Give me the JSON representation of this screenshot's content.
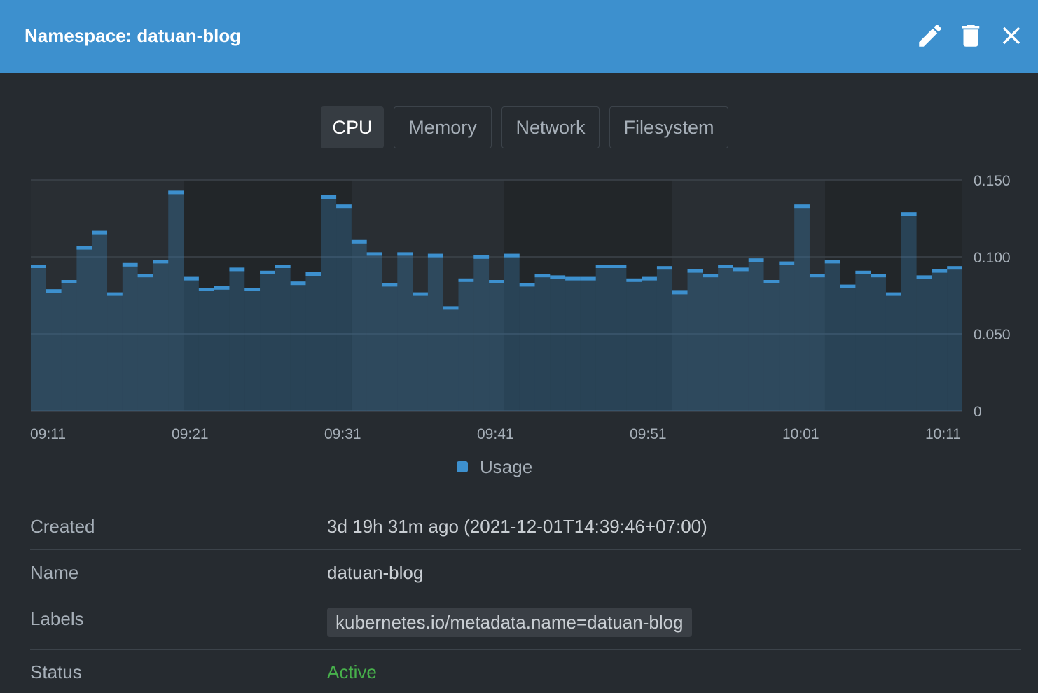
{
  "header": {
    "title": "Namespace: datuan-blog",
    "actions": [
      {
        "name": "edit",
        "icon": "pencil-icon"
      },
      {
        "name": "delete",
        "icon": "trash-icon"
      },
      {
        "name": "close",
        "icon": "close-icon"
      }
    ]
  },
  "tabs": [
    {
      "label": "CPU",
      "active": true
    },
    {
      "label": "Memory",
      "active": false
    },
    {
      "label": "Network",
      "active": false
    },
    {
      "label": "Filesystem",
      "active": false
    }
  ],
  "chart_data": {
    "type": "bar",
    "series": [
      {
        "name": "Usage",
        "color": "#3d90ce",
        "values": [
          0.095,
          0.079,
          0.085,
          0.107,
          0.117,
          0.077,
          0.096,
          0.089,
          0.098,
          0.143,
          0.087,
          0.08,
          0.081,
          0.093,
          0.08,
          0.091,
          0.095,
          0.084,
          0.09,
          0.14,
          0.134,
          0.111,
          0.103,
          0.083,
          0.103,
          0.077,
          0.102,
          0.068,
          0.086,
          0.101,
          0.085,
          0.102,
          0.083,
          0.089,
          0.088,
          0.087,
          0.087,
          0.095,
          0.095,
          0.086,
          0.087,
          0.094,
          0.078,
          0.092,
          0.089,
          0.095,
          0.093,
          0.099,
          0.085,
          0.097,
          0.134,
          0.089,
          0.098,
          0.082,
          0.091,
          0.089,
          0.077,
          0.129,
          0.088,
          0.092,
          0.094
        ]
      }
    ],
    "x_tick_labels": [
      "09:11",
      "09:21",
      "09:31",
      "09:41",
      "09:51",
      "10:01",
      "10:11"
    ],
    "y_tick_labels": [
      "0.150",
      "0.100",
      "0.050",
      "0"
    ],
    "y_ticks": [
      0.15,
      0.1,
      0.05,
      0
    ],
    "ylim": [
      0,
      0.15
    ],
    "grid": true,
    "legend_placement": "bottom-center"
  },
  "legend": {
    "label": "Usage",
    "color": "#3d90ce"
  },
  "details": [
    {
      "key": "Created",
      "value": "3d 19h 31m ago (2021-12-01T14:39:46+07:00)"
    },
    {
      "key": "Name",
      "value": "datuan-blog"
    },
    {
      "key": "Labels",
      "value": "kubernetes.io/metadata.name=datuan-blog"
    },
    {
      "key": "Status",
      "value": "Active",
      "color": "#47b04b"
    }
  ]
}
